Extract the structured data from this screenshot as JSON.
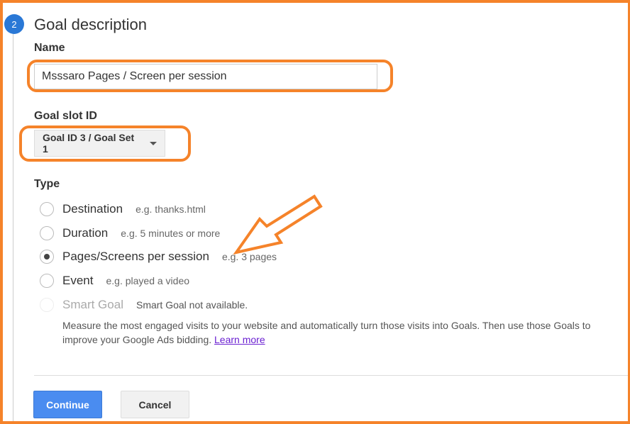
{
  "step_number": "2",
  "title": "Goal description",
  "name": {
    "label": "Name",
    "value": "Msssaro Pages / Screen per session"
  },
  "slot": {
    "label": "Goal slot ID",
    "selected": "Goal ID 3 / Goal Set 1"
  },
  "type": {
    "label": "Type",
    "options": [
      {
        "label": "Destination",
        "hint": "e.g. thanks.html",
        "selected": false
      },
      {
        "label": "Duration",
        "hint": "e.g. 5 minutes or more",
        "selected": false
      },
      {
        "label": "Pages/Screens per session",
        "hint": "e.g. 3 pages",
        "selected": true
      },
      {
        "label": "Event",
        "hint": "e.g. played a video",
        "selected": false
      },
      {
        "label": "Smart Goal",
        "hint": "Smart Goal not available.",
        "selected": false,
        "disabled": true
      }
    ],
    "smart_desc": "Measure the most engaged visits to your website and automatically turn those visits into Goals. Then use those Goals to improve your Google Ads bidding.",
    "learn_more": "Learn more"
  },
  "buttons": {
    "continue": "Continue",
    "cancel": "Cancel"
  },
  "colors": {
    "annotation": "#f5832a",
    "primary": "#4a8cf0",
    "step": "#2a78d6"
  }
}
